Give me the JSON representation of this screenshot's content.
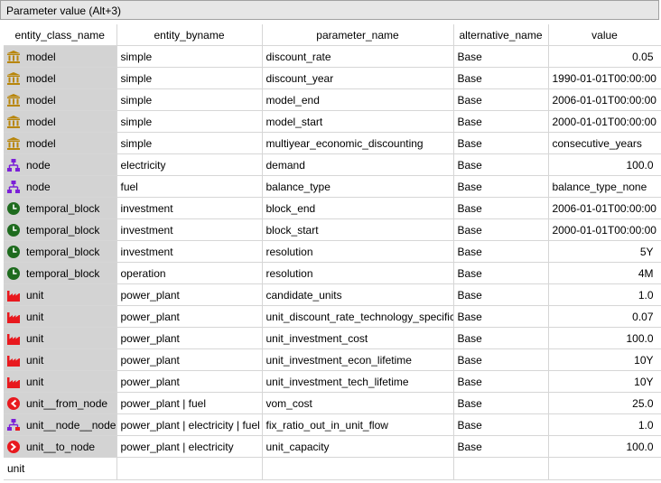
{
  "window": {
    "title": "Parameter value (Alt+3)"
  },
  "columns": [
    "entity_class_name",
    "entity_byname",
    "parameter_name",
    "alternative_name",
    "value"
  ],
  "rows": [
    {
      "class": "model",
      "icon": "bank-icon",
      "byname": "simple",
      "param": "discount_rate",
      "alt": "Base",
      "value": "0.05",
      "num": true
    },
    {
      "class": "model",
      "icon": "bank-icon",
      "byname": "simple",
      "param": "discount_year",
      "alt": "Base",
      "value": "1990-01-01T00:00:00",
      "num": false
    },
    {
      "class": "model",
      "icon": "bank-icon",
      "byname": "simple",
      "param": "model_end",
      "alt": "Base",
      "value": "2006-01-01T00:00:00",
      "num": false
    },
    {
      "class": "model",
      "icon": "bank-icon",
      "byname": "simple",
      "param": "model_start",
      "alt": "Base",
      "value": "2000-01-01T00:00:00",
      "num": false
    },
    {
      "class": "model",
      "icon": "bank-icon",
      "byname": "simple",
      "param": "multiyear_economic_discounting",
      "alt": "Base",
      "value": "consecutive_years",
      "num": false
    },
    {
      "class": "node",
      "icon": "network-icon",
      "byname": "electricity",
      "param": "demand",
      "alt": "Base",
      "value": "100.0",
      "num": true
    },
    {
      "class": "node",
      "icon": "network-icon",
      "byname": "fuel",
      "param": "balance_type",
      "alt": "Base",
      "value": "balance_type_none",
      "num": false
    },
    {
      "class": "temporal_block",
      "icon": "clock-icon",
      "byname": "investment",
      "param": "block_end",
      "alt": "Base",
      "value": "2006-01-01T00:00:00",
      "num": false
    },
    {
      "class": "temporal_block",
      "icon": "clock-icon",
      "byname": "investment",
      "param": "block_start",
      "alt": "Base",
      "value": "2000-01-01T00:00:00",
      "num": false
    },
    {
      "class": "temporal_block",
      "icon": "clock-icon",
      "byname": "investment",
      "param": "resolution",
      "alt": "Base",
      "value": "5Y",
      "num": true
    },
    {
      "class": "temporal_block",
      "icon": "clock-icon",
      "byname": "operation",
      "param": "resolution",
      "alt": "Base",
      "value": "4M",
      "num": true
    },
    {
      "class": "unit",
      "icon": "factory-icon",
      "byname": "power_plant",
      "param": "candidate_units",
      "alt": "Base",
      "value": "1.0",
      "num": true
    },
    {
      "class": "unit",
      "icon": "factory-icon",
      "byname": "power_plant",
      "param": "unit_discount_rate_technology_specific",
      "alt": "Base",
      "value": "0.07",
      "num": true
    },
    {
      "class": "unit",
      "icon": "factory-icon",
      "byname": "power_plant",
      "param": "unit_investment_cost",
      "alt": "Base",
      "value": "100.0",
      "num": true
    },
    {
      "class": "unit",
      "icon": "factory-icon",
      "byname": "power_plant",
      "param": "unit_investment_econ_lifetime",
      "alt": "Base",
      "value": "10Y",
      "num": true
    },
    {
      "class": "unit",
      "icon": "factory-icon",
      "byname": "power_plant",
      "param": "unit_investment_tech_lifetime",
      "alt": "Base",
      "value": "10Y",
      "num": true
    },
    {
      "class": "unit__from_node",
      "icon": "arrow-left-circle-icon",
      "byname": "power_plant | fuel",
      "param": "vom_cost",
      "alt": "Base",
      "value": "25.0",
      "num": true
    },
    {
      "class": "unit__node__node",
      "icon": "unit-node-node-icon",
      "byname": "power_plant | electricity | fuel",
      "param": "fix_ratio_out_in_unit_flow",
      "alt": "Base",
      "value": "1.0",
      "num": true
    },
    {
      "class": "unit__to_node",
      "icon": "arrow-right-circle-icon",
      "byname": "power_plant | electricity",
      "param": "unit_capacity",
      "alt": "Base",
      "value": "100.0",
      "num": true
    }
  ],
  "new_row": {
    "class": "unit"
  },
  "colors": {
    "titlebar": "#e6e6e6",
    "class_cell": "#d3d3d3",
    "grid_line": "#d6d6d6",
    "model_icon": "#b8860b",
    "node_icon": "#7b1fd8",
    "clock_icon": "#1e6b1e",
    "unit_icon": "#e8191e"
  }
}
